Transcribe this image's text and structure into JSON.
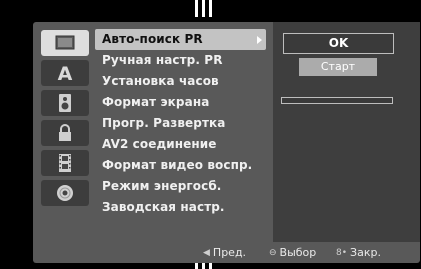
{
  "menu": {
    "items": [
      {
        "label": "Авто-поиск PR",
        "selected": true
      },
      {
        "label": "Ручная настр. PR"
      },
      {
        "label": "Установка часов"
      },
      {
        "label": "Формат экрана"
      },
      {
        "label": "Прогр. Развертка"
      },
      {
        "label": "AV2 соединение"
      },
      {
        "label": "Формат видео воспр."
      },
      {
        "label": "Режим энергосб."
      },
      {
        "label": "Заводская настр."
      }
    ]
  },
  "side_tabs": {
    "items": [
      {
        "icon": "tv-screen-icon",
        "active": true
      },
      {
        "icon": "language-a-icon",
        "active": false
      },
      {
        "icon": "speaker-icon",
        "active": false
      },
      {
        "icon": "lock-icon",
        "active": false
      },
      {
        "icon": "film-icon",
        "active": false
      },
      {
        "icon": "disc-icon",
        "active": false
      }
    ]
  },
  "right_panel": {
    "ok_label": "OK",
    "start_label": "Старт",
    "progress_fraction": 0.0
  },
  "footer": {
    "prev_label": "Пред.",
    "select_label": "Выбор",
    "close_label": "Закр."
  },
  "colors": {
    "panel": "#595959",
    "selected_row": "#c3c3c3",
    "right_area": "#3e3e3e"
  }
}
